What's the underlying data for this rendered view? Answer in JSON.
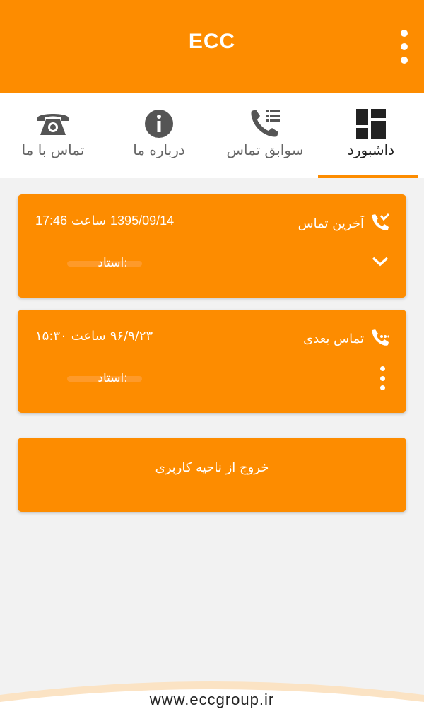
{
  "app": {
    "title": "ECC",
    "menu_icon": "more-vert-icon",
    "accent_color": "#fd8c00"
  },
  "tabs": [
    {
      "label": "داشبورد",
      "icon": "dashboard-icon",
      "active": true
    },
    {
      "label": "سوابق تماس",
      "icon": "call-history-icon",
      "active": false
    },
    {
      "label": "درباره ما",
      "icon": "info-icon",
      "active": false
    },
    {
      "label": "تماس با ما",
      "icon": "telephone-icon",
      "active": false
    }
  ],
  "last_call": {
    "label": "آخرین تماس",
    "icon": "call-received-icon",
    "date": "1395/09/14",
    "time_word": "ساعت",
    "time": "17:46",
    "teacher_label": "استاد:",
    "expand_icon": "chevron-down-icon"
  },
  "next_call": {
    "label": "تماس بعدی",
    "icon": "call-scheduled-icon",
    "date": "۹۶/۹/۲۳",
    "time_word": "ساعت",
    "time": "۱۵:۳۰",
    "teacher_label": "استاد:",
    "more_icon": "more-vert-icon"
  },
  "logout": {
    "label": "خروج از ناحیه کاربری"
  },
  "footer": {
    "url": "www.eccgroup.ir"
  }
}
